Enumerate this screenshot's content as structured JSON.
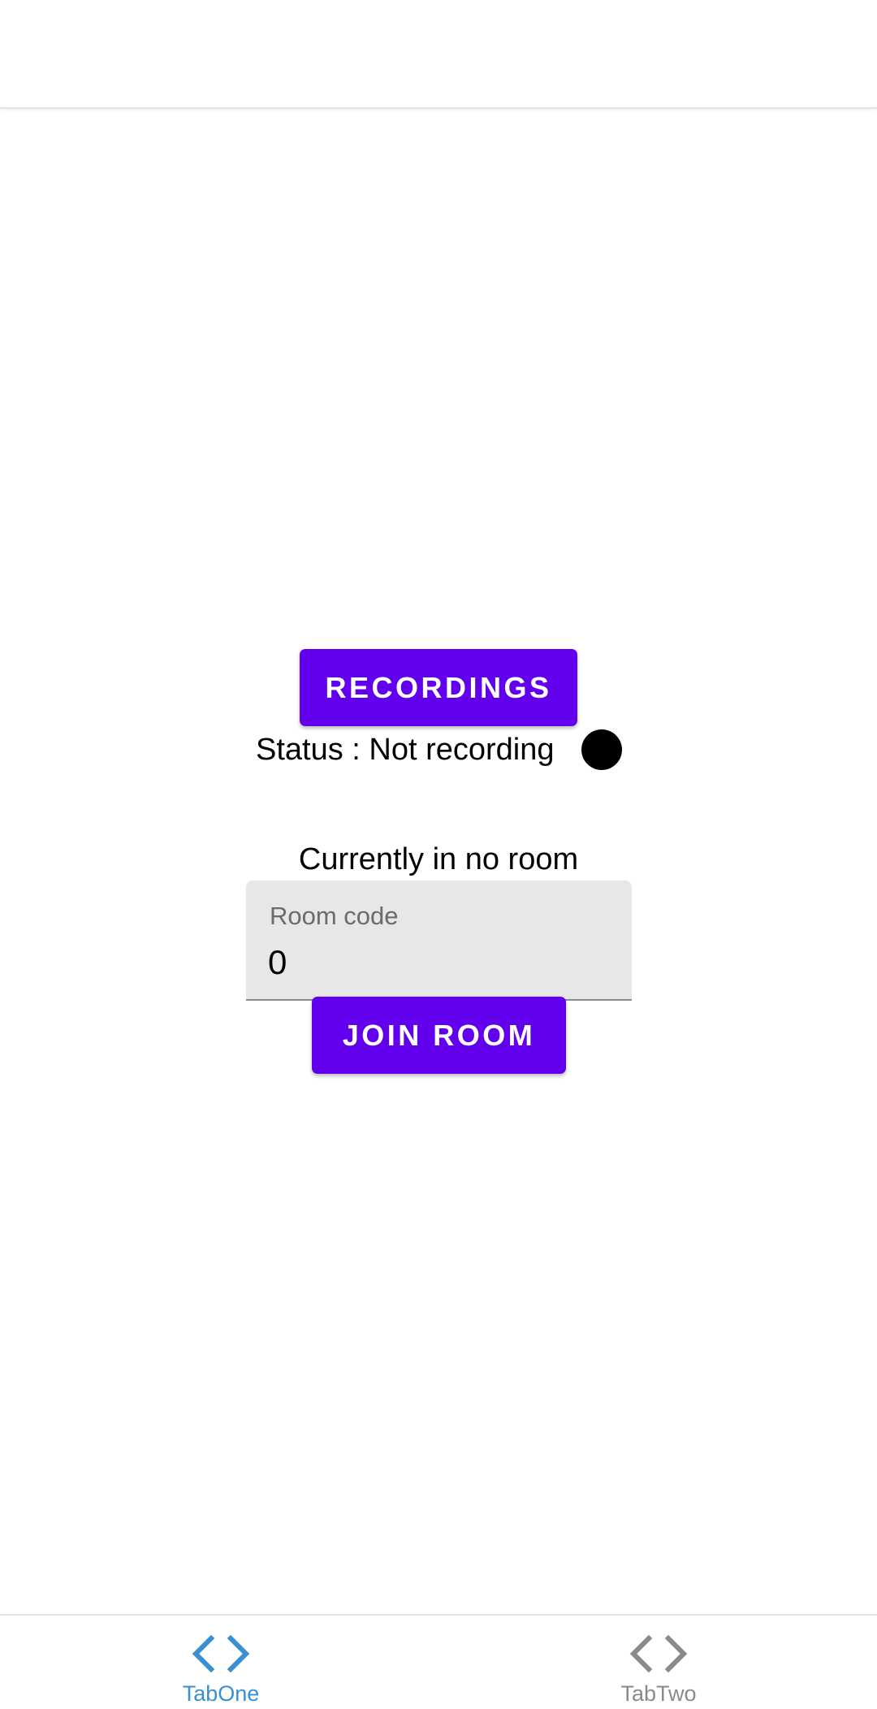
{
  "recordings_button": {
    "label": "RECORDINGS"
  },
  "status": {
    "text": "Status : Not recording"
  },
  "room": {
    "current_label": "Currently in no room",
    "field_label": "Room code",
    "field_value": "0",
    "join_label": "JOIN ROOM"
  },
  "tabs": [
    {
      "label": "TabOne",
      "icon": "code-icon",
      "active": true
    },
    {
      "label": "TabTwo",
      "icon": "code-icon",
      "active": false
    }
  ],
  "colors": {
    "primary": "#6200ee",
    "tab_active": "#3a8fd0",
    "tab_inactive": "#8a8a8a"
  }
}
